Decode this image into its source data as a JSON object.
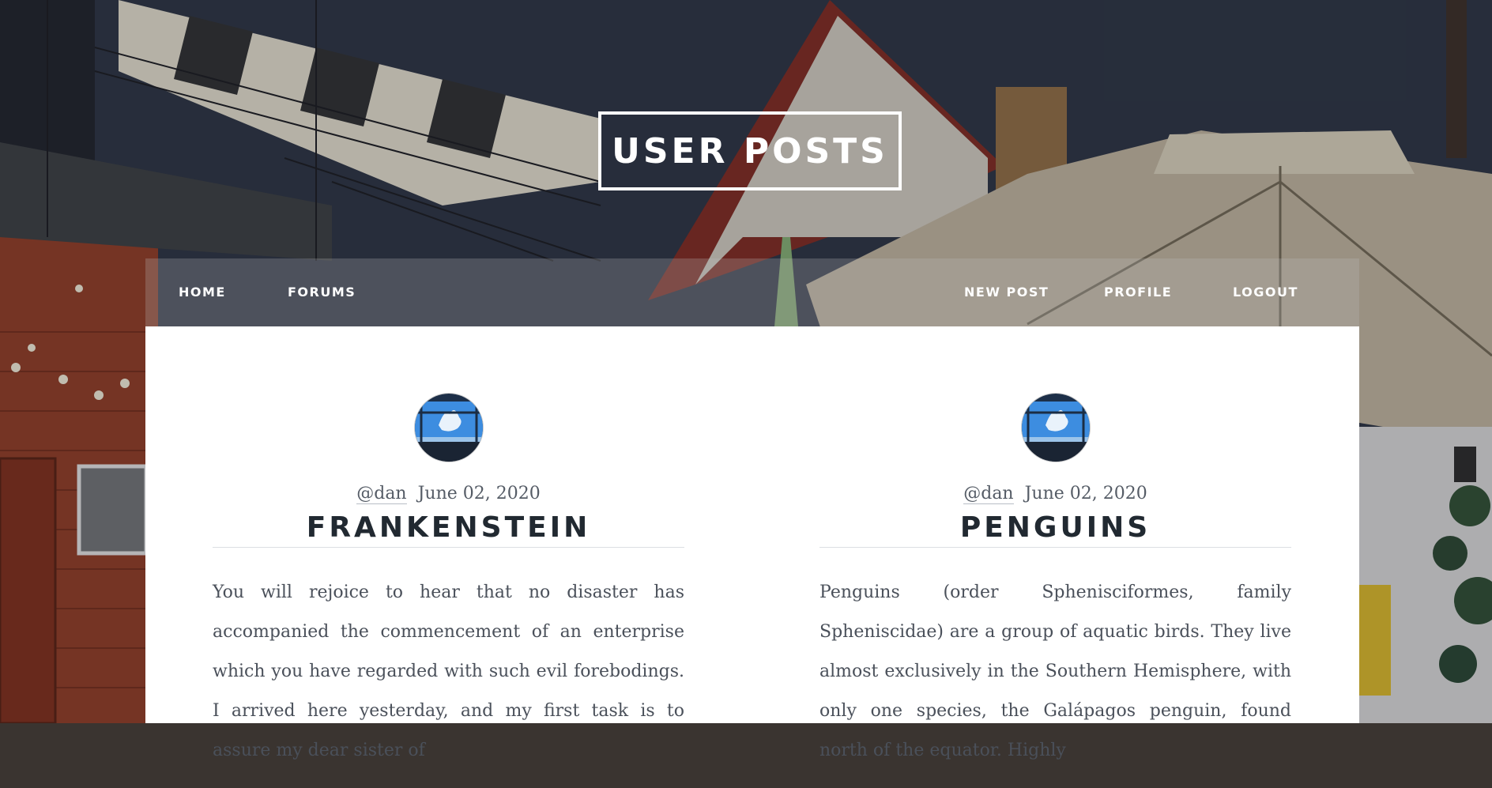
{
  "header": {
    "title": "User Posts"
  },
  "nav": {
    "left": [
      {
        "label": "Home"
      },
      {
        "label": "Forums"
      }
    ],
    "right": [
      {
        "label": "New Post"
      },
      {
        "label": "Profile"
      },
      {
        "label": "Logout"
      }
    ]
  },
  "posts": [
    {
      "author": "@dan",
      "date": "June 02, 2020",
      "title": "Frankenstein",
      "body": "You will rejoice to hear that no disaster has accompanied the commencement of an enterprise which you have regarded with such evil forebodings. I arrived here yesterday, and my first task is to assure my dear sister of"
    },
    {
      "author": "@dan",
      "date": "June 02, 2020",
      "title": "Penguins",
      "body": "Penguins (order Sphenisciformes, family Spheniscidae) are a group of aquatic birds. They live almost exclusively in the Southern Hemisphere, with only one species, the Galápagos penguin, found north of the equator. Highly"
    }
  ],
  "colors": {
    "accent_text": "#212931",
    "nav_bg": "rgba(190,190,190,0.25)",
    "card_bg": "#ffffff"
  }
}
